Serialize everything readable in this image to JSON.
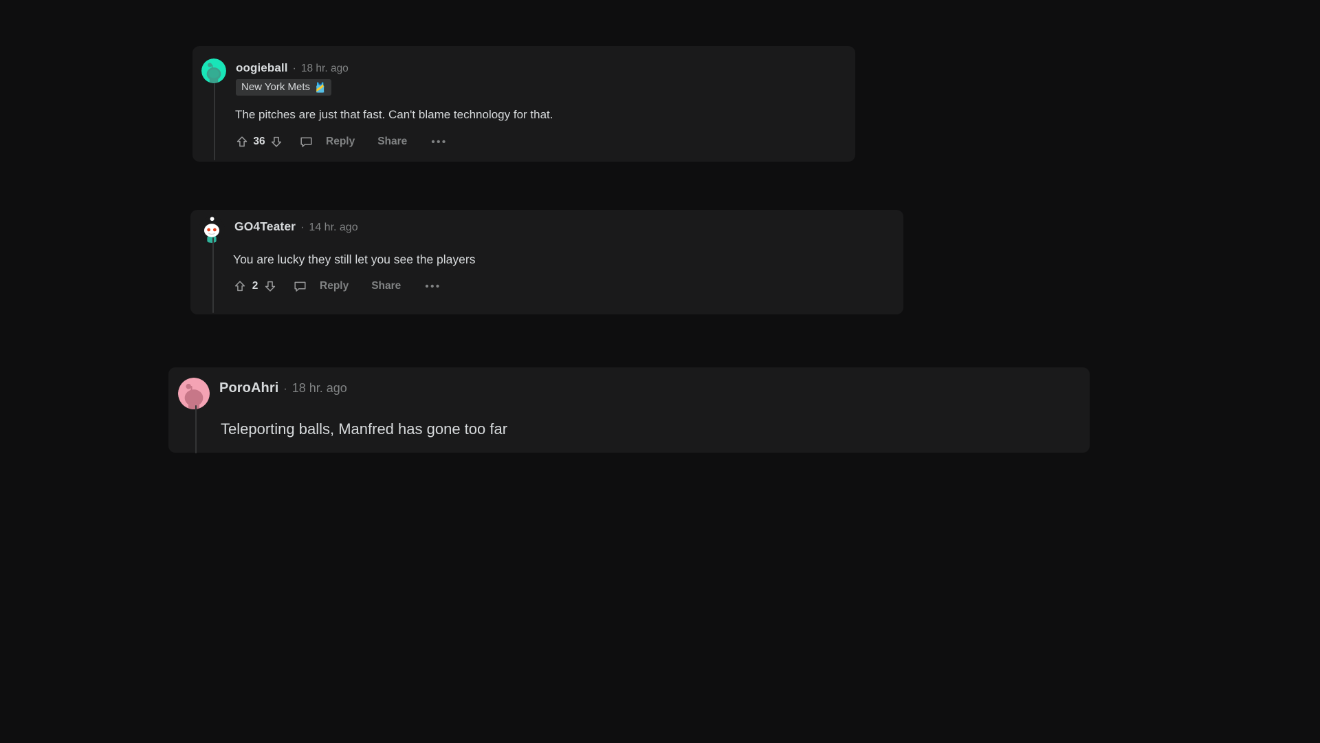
{
  "theme": {
    "page_bg": "#0e0e0f",
    "card_bg": "#1a1a1b",
    "text_primary": "#d7dadc",
    "text_muted": "#818384",
    "threadline": "#343536",
    "flair_bg": "#343536"
  },
  "comments": [
    {
      "id": "c1",
      "username": "oogieball",
      "separator": "·",
      "timestamp": "18 hr. ago",
      "flair": {
        "label": "New York Mets",
        "emoji": "🎽"
      },
      "body": "The pitches are just that fast. Can't blame technology for that.",
      "score": "36",
      "reply_label": "Reply",
      "share_label": "Share",
      "more_label": "•••",
      "avatar": {
        "name": "snoo-avatar-teal",
        "bg": "#19e5b8",
        "fg": "#3aa18c"
      }
    },
    {
      "id": "c2",
      "username": "GO4Teater",
      "separator": "·",
      "timestamp": "14 hr. ago",
      "flair": null,
      "body": "You are lucky they still let you see the players",
      "score": "2",
      "reply_label": "Reply",
      "share_label": "Share",
      "more_label": "•••",
      "avatar": {
        "name": "snoo-avatar-white",
        "bg": "#1a1a1b",
        "head": "#ffffff",
        "eye": "#e8431f",
        "shirt": "#2fb39b",
        "antenna": "#1d1d1e"
      }
    },
    {
      "id": "c3",
      "username": "PoroAhri",
      "separator": "·",
      "timestamp": "18 hr. ago",
      "flair": null,
      "body": "Teleporting balls, Manfred has gone too far",
      "avatar": {
        "name": "snoo-avatar-pink",
        "bg": "#f4a3b4",
        "fg": "#c77788"
      }
    }
  ],
  "icons": {
    "upvote": "upvote-arrow-icon",
    "downvote": "downvote-arrow-icon",
    "comment": "comment-bubble-icon",
    "overflow": "overflow-menu-icon"
  }
}
